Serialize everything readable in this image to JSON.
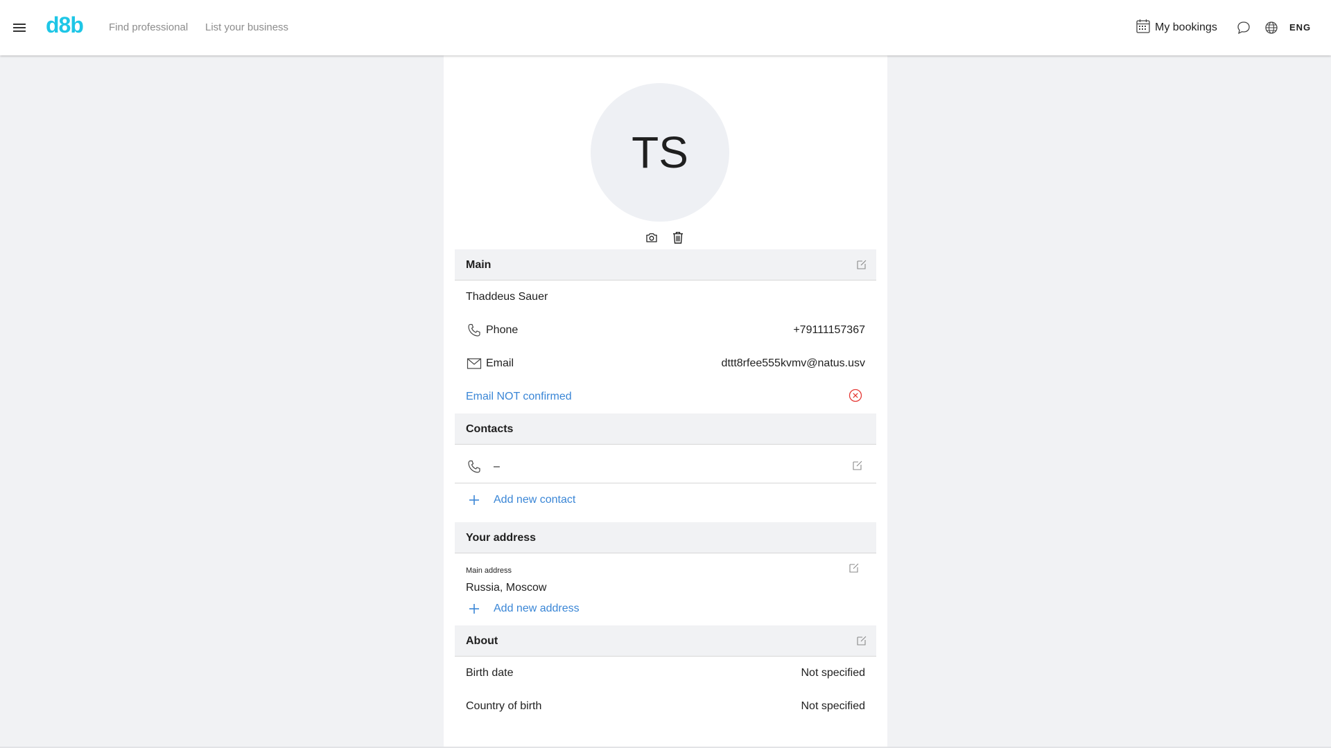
{
  "header": {
    "logo": "d8b",
    "nav": [
      "Find professional",
      "List your business"
    ],
    "bookings_label": "My bookings",
    "language": "ENG"
  },
  "profile": {
    "initials": "TS"
  },
  "main": {
    "title": "Main",
    "name": "Thaddeus Sauer",
    "phone_label": "Phone",
    "phone_value": "+79111157367",
    "email_label": "Email",
    "email_value": "dttt8rfee555kvmv@natus.usv",
    "email_status": "Email NOT confirmed"
  },
  "contacts": {
    "title": "Contacts",
    "items": [
      {
        "value": "–"
      }
    ],
    "add_label": "Add new contact"
  },
  "address": {
    "title": "Your address",
    "main_label": "Main address",
    "main_value": "Russia, Moscow",
    "add_label": "Add new address"
  },
  "about": {
    "title": "About",
    "birth_date_label": "Birth date",
    "birth_date_value": "Not specified",
    "country_label": "Country of birth",
    "country_value": "Not specified"
  },
  "colors": {
    "brand": "#1ec6e6",
    "link": "#3a86d6",
    "error": "#e53935",
    "section_bg": "#f1f2f4"
  }
}
